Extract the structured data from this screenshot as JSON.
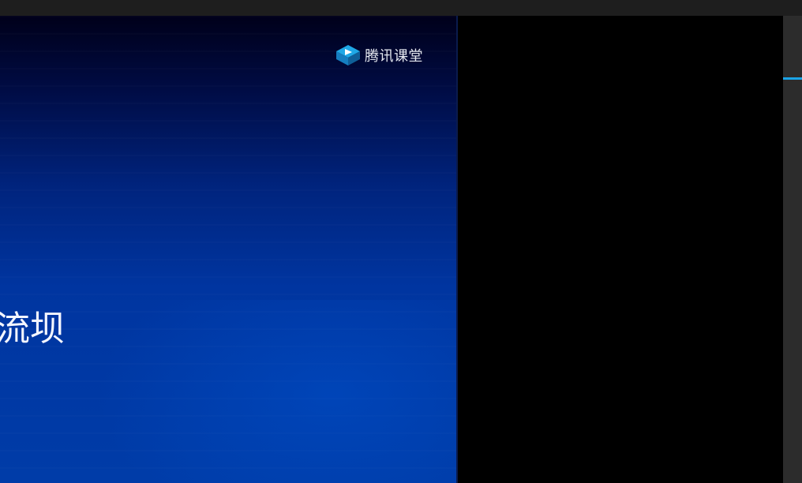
{
  "brand": {
    "name": "腾讯课堂"
  },
  "slide": {
    "title_fragment": "流坝"
  },
  "colors": {
    "top_bar": "#1e1e1e",
    "video_gradient_top": "#00001a",
    "video_gradient_bottom": "#003ca8",
    "side_panel": "#2c2c2c",
    "accent": "#1aa4e8"
  },
  "icons": {
    "brand_logo": "tencent-classroom-logo-icon"
  }
}
